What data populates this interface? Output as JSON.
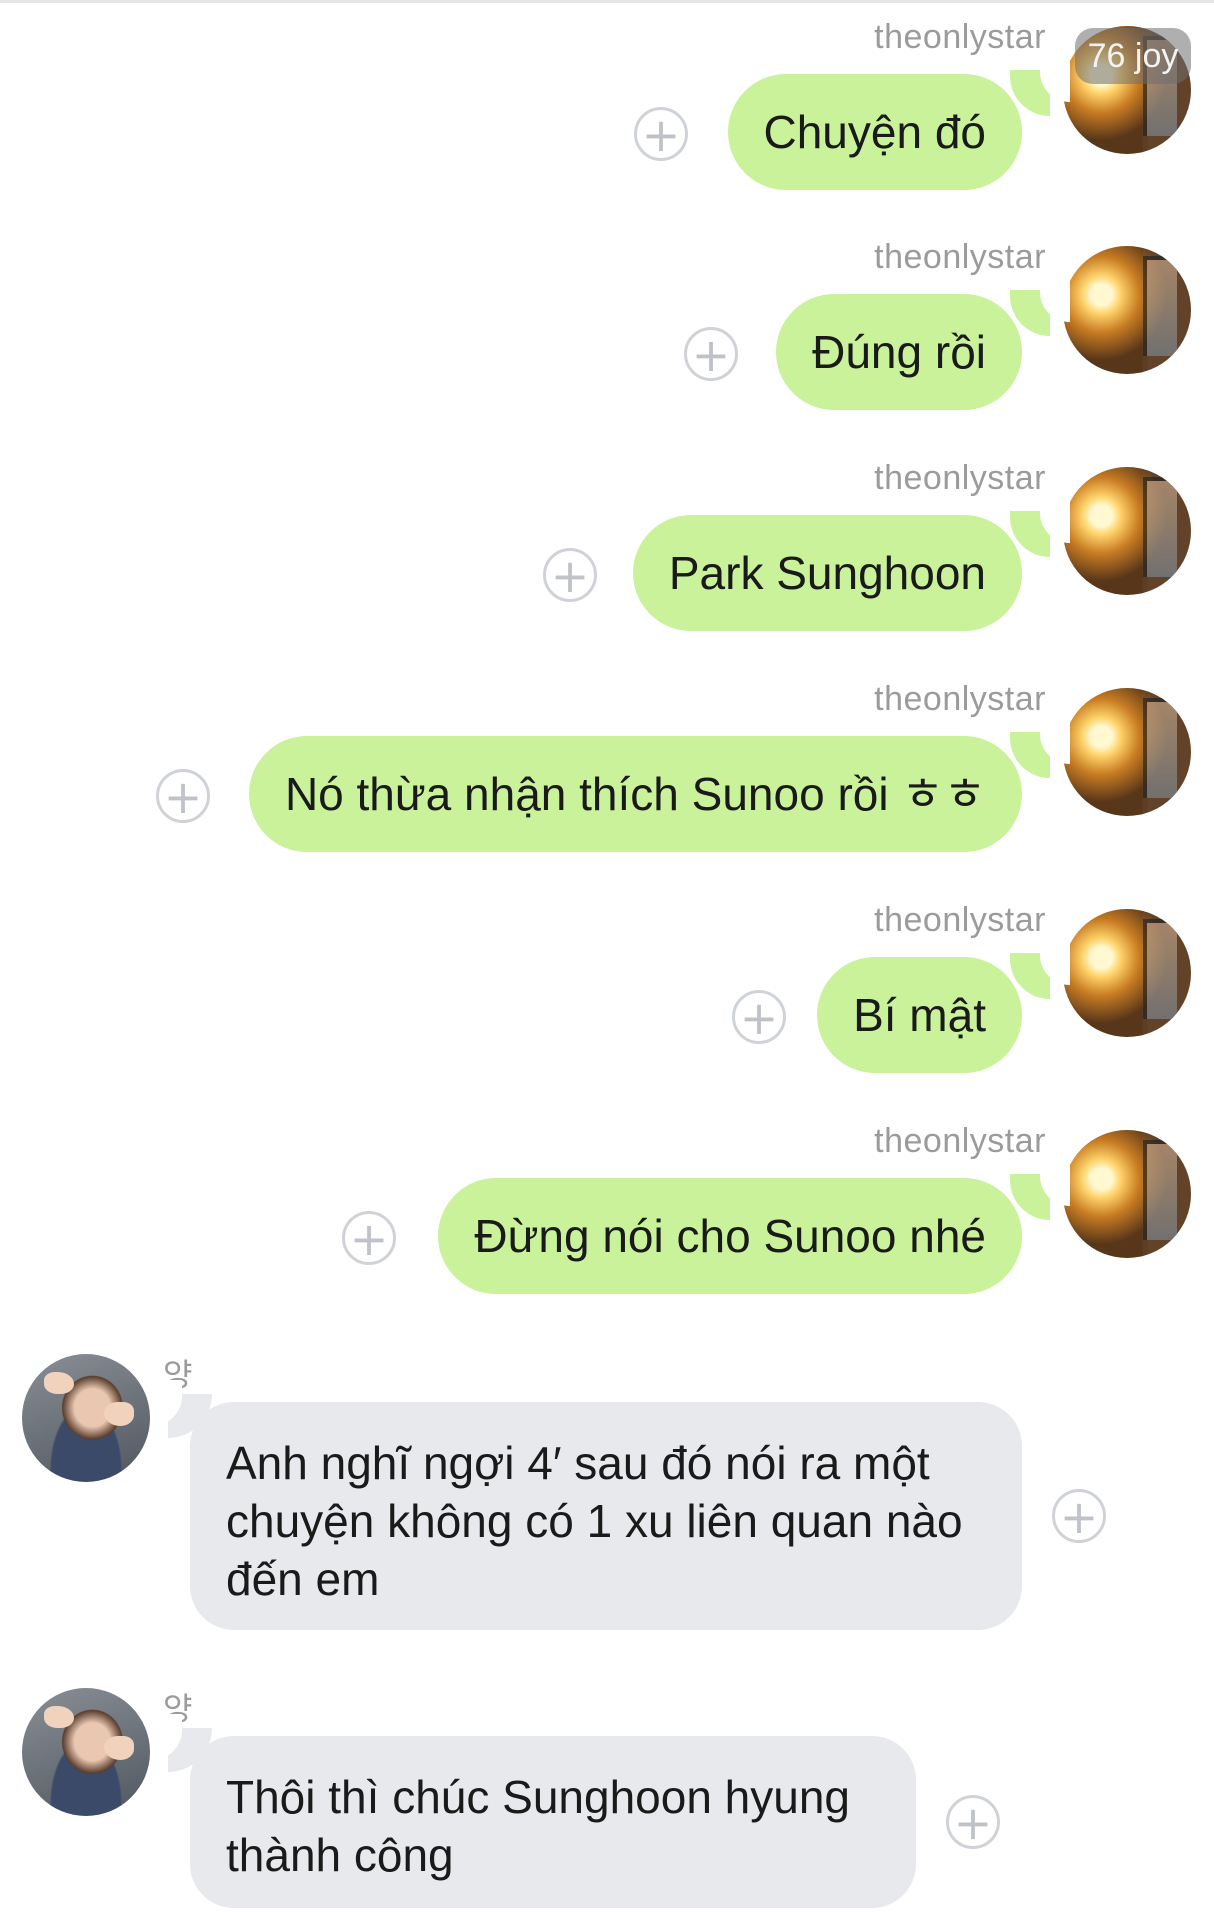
{
  "badge": {
    "text": "76 joy"
  },
  "messages": [
    {
      "side": "out",
      "sender": "theonlystar",
      "text": "Chuyện đó"
    },
    {
      "side": "out",
      "sender": "theonlystar",
      "text": "Đúng rồi"
    },
    {
      "side": "out",
      "sender": "theonlystar",
      "text": "Park Sunghoon"
    },
    {
      "side": "out",
      "sender": "theonlystar",
      "text": "Nó thừa nhận thích Sunoo rồi ㅎㅎ"
    },
    {
      "side": "out",
      "sender": "theonlystar",
      "text": "Bí mật"
    },
    {
      "side": "out",
      "sender": "theonlystar",
      "text": "Đừng nói cho Sunoo nhé"
    },
    {
      "side": "in",
      "sender": "양",
      "text": "Anh nghĩ ngợi 4′ sau đó nói ra một chuyện không có 1 xu liên quan nào đến em"
    },
    {
      "side": "in",
      "sender": "양",
      "text": "Thôi thì chúc Sunghoon hyung thành công"
    }
  ],
  "icons": {
    "add": "plus-circle-icon"
  },
  "colors": {
    "outgoing_bubble": "#c9f29b",
    "incoming_bubble": "#e8e9ec",
    "sender_text": "#9b9b9b"
  }
}
